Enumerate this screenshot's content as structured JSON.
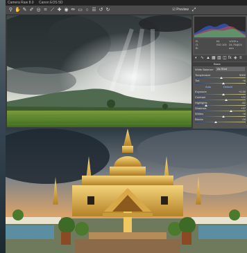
{
  "app": {
    "title": "Camera Raw 8.0",
    "title_extra": "Canon EOS 5D"
  },
  "toolbar": {
    "tools": [
      "zoom-icon",
      "hand-icon",
      "white-balance-icon",
      "color-sampler-icon",
      "target-adjust-icon",
      "crop-icon",
      "straighten-icon",
      "spot-removal-icon",
      "red-eye-icon",
      "adjustment-brush-icon",
      "graduated-filter-icon",
      "radial-filter-icon",
      "preferences-icon",
      "rotate-ccw-icon",
      "rotate-cw-icon"
    ],
    "preview_label": "Preview"
  },
  "histogram": {
    "colors": [
      "#2f5fd0",
      "#d04a4a",
      "#42c06a"
    ]
  },
  "readout": {
    "r": "R:",
    "g": "G:",
    "b": "B:",
    "f": "f/4",
    "iso": "ISO 100",
    "shutter": "1/100 s",
    "focal": "24-70@24 mm"
  },
  "panel": {
    "section": "Basic",
    "white_balance_label": "White Balance:",
    "white_balance_value": "As Shot",
    "auto_label": "Auto",
    "default_label": "Default",
    "sliders": [
      {
        "label": "Temperature",
        "value": "5000",
        "level": 0.5
      },
      {
        "label": "Tint",
        "value": "+6",
        "level": 0.55
      },
      {
        "label": "Exposure",
        "value": "+0.30",
        "level": 0.55
      },
      {
        "label": "Contrast",
        "value": "+22",
        "level": 0.6
      },
      {
        "label": "Highlights",
        "value": "-62",
        "level": 0.2
      },
      {
        "label": "Shadows",
        "value": "+37",
        "level": 0.7
      },
      {
        "label": "Whites",
        "value": "+8",
        "level": 0.55
      },
      {
        "label": "Blacks",
        "value": "-18",
        "level": 0.4
      }
    ]
  }
}
